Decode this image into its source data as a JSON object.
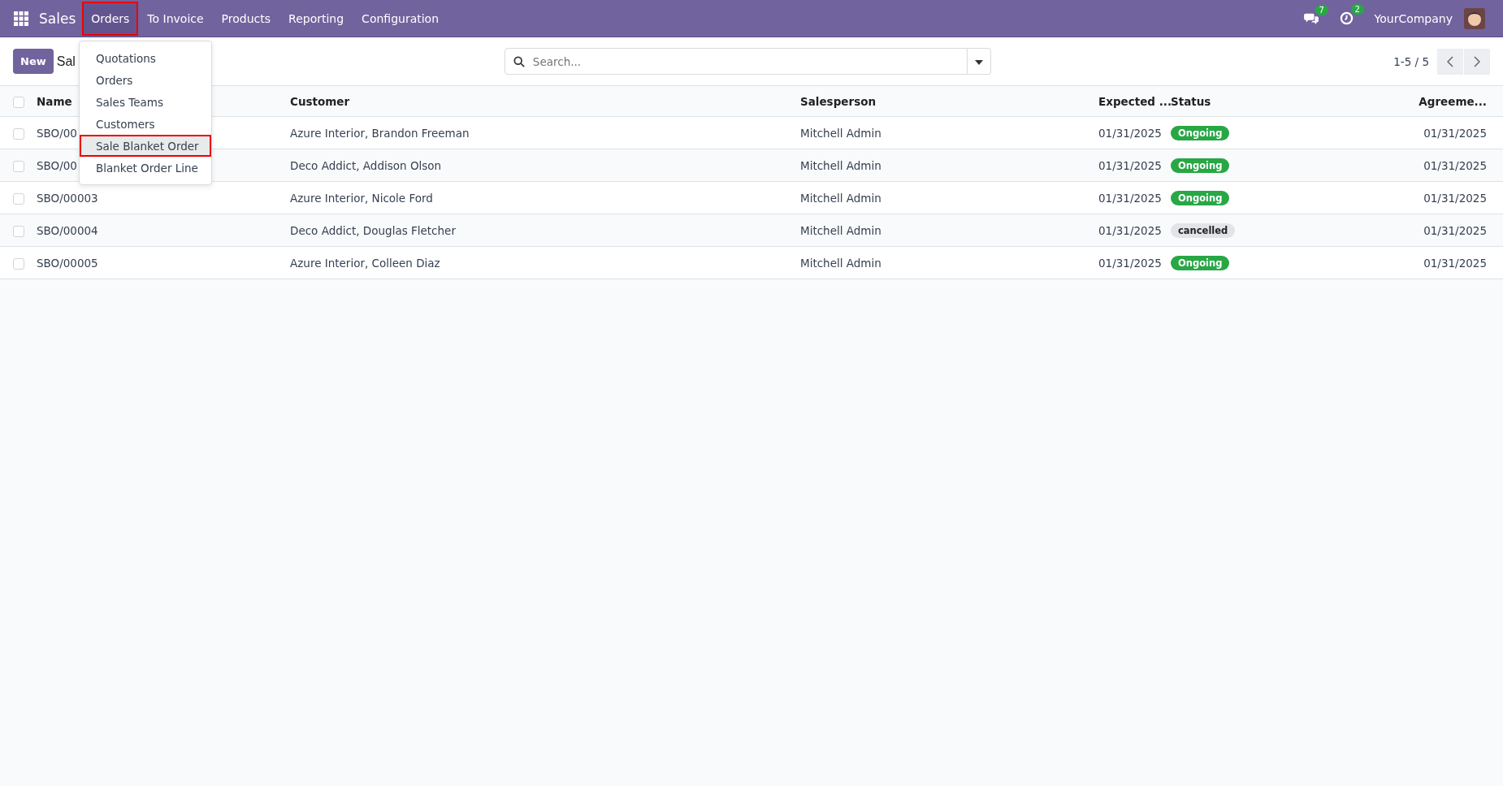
{
  "navbar": {
    "app_name": "Sales",
    "menus": [
      {
        "label": "Orders",
        "selected": true,
        "highlighted": true
      },
      {
        "label": "To Invoice",
        "selected": false,
        "highlighted": false
      },
      {
        "label": "Products",
        "selected": false,
        "highlighted": false
      },
      {
        "label": "Reporting",
        "selected": false,
        "highlighted": false
      },
      {
        "label": "Configuration",
        "selected": false,
        "highlighted": false
      }
    ],
    "messages_count": "7",
    "activities_count": "2",
    "company": "YourCompany"
  },
  "dropdown": {
    "items": [
      {
        "label": "Quotations",
        "highlighted": false
      },
      {
        "label": "Orders",
        "highlighted": false
      },
      {
        "label": "Sales Teams",
        "highlighted": false
      },
      {
        "label": "Customers",
        "highlighted": false
      },
      {
        "label": "Sale Blanket Order",
        "highlighted": true
      },
      {
        "label": "Blanket Order Line",
        "highlighted": false
      }
    ]
  },
  "control_panel": {
    "new_button": "New",
    "title": "Sal",
    "search": {
      "placeholder": "Search..."
    },
    "pager": "1-5 / 5"
  },
  "table": {
    "columns": [
      "Name",
      "Customer",
      "Salesperson",
      "Expected ...",
      "Status",
      "Agreeme..."
    ],
    "all_selected": false,
    "rows": [
      {
        "checked": false,
        "name": "SBO/00",
        "customer": "Azure Interior, Brandon Freeman",
        "salesperson": "Mitchell Admin",
        "expected": "01/31/2025",
        "status": {
          "label": "Ongoing",
          "kind": "ongoing"
        },
        "agreement": "01/31/2025"
      },
      {
        "checked": false,
        "name": "SBO/00",
        "customer": "Deco Addict, Addison Olson",
        "salesperson": "Mitchell Admin",
        "expected": "01/31/2025",
        "status": {
          "label": "Ongoing",
          "kind": "ongoing"
        },
        "agreement": "01/31/2025"
      },
      {
        "checked": false,
        "name": "SBO/00003",
        "customer": "Azure Interior, Nicole Ford",
        "salesperson": "Mitchell Admin",
        "expected": "01/31/2025",
        "status": {
          "label": "Ongoing",
          "kind": "ongoing"
        },
        "agreement": "01/31/2025"
      },
      {
        "checked": false,
        "name": "SBO/00004",
        "customer": "Deco Addict, Douglas Fletcher",
        "salesperson": "Mitchell Admin",
        "expected": "01/31/2025",
        "status": {
          "label": "cancelled",
          "kind": "cancelled"
        },
        "agreement": "01/31/2025"
      },
      {
        "checked": false,
        "name": "SBO/00005",
        "customer": "Azure Interior, Colleen Diaz",
        "salesperson": "Mitchell Admin",
        "expected": "01/31/2025",
        "status": {
          "label": "Ongoing",
          "kind": "ongoing"
        },
        "agreement": "01/31/2025"
      }
    ]
  }
}
